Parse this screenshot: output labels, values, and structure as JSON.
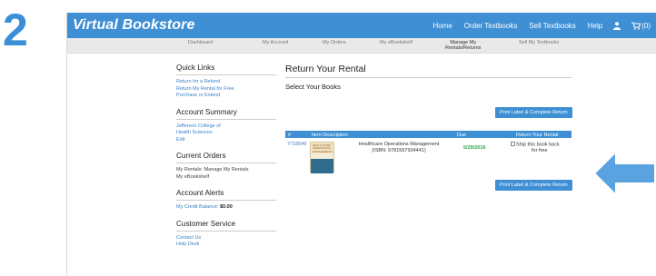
{
  "step_number": "2",
  "app": {
    "brand": "Virtual Bookstore",
    "topnav": {
      "home": "Home",
      "order": "Order Textbooks",
      "sell": "Sell Textbooks",
      "help": "Help",
      "cart": "(0)"
    },
    "subnav": [
      "Dashboard",
      "My Account",
      "My Orders",
      "My eBookshelf",
      "Manage My\nRentals/Returns",
      "Sell My Textbooks"
    ]
  },
  "sidebar": {
    "quick_links": {
      "heading": "Quick Links",
      "items": [
        "Return for a Refund",
        "Return My Rental for Free",
        "Purchase or Extend"
      ]
    },
    "account_summary": {
      "heading": "Account Summary",
      "lines": [
        "Jefferson College of",
        "Health Sciences"
      ],
      "edit": "Edit"
    },
    "current_orders": {
      "heading": "Current Orders",
      "line1": "My Rentals: Manage My Rentals",
      "line2": "My eBookshelf"
    },
    "account_alerts": {
      "heading": "Account Alerts",
      "credit_label": "My Credit Balance:",
      "credit_value": "$0.00"
    },
    "customer_service": {
      "heading": "Customer Service",
      "items": [
        "Contact Us",
        "Help Desk"
      ]
    }
  },
  "main": {
    "title": "Return Your Rental",
    "subtitle": "Select Your Books",
    "button_label": "Print Label & Complete Return",
    "table": {
      "headers": [
        "#",
        "Item Description",
        "Due",
        "Return Your Rental"
      ],
      "rows": [
        {
          "id": "7718549",
          "book_cover_text": "HEALTHCARE OPERATIONS MANAGEMENT",
          "title": "Healthcare Operations Management",
          "isbn": "(ISBN: 9781567934441)",
          "due": "5/29/2016",
          "ship_label": "Ship this book back",
          "ship_label2": "for free"
        }
      ]
    }
  },
  "colors": {
    "brand_blue": "#3e8fd4",
    "step_blue": "#3a8fd6",
    "due_green": "#2fa84a",
    "link_blue": "#3a7fc9"
  },
  "icons": {
    "user": "user-icon",
    "cart": "cart-icon",
    "arrow": "left-arrow-icon"
  }
}
